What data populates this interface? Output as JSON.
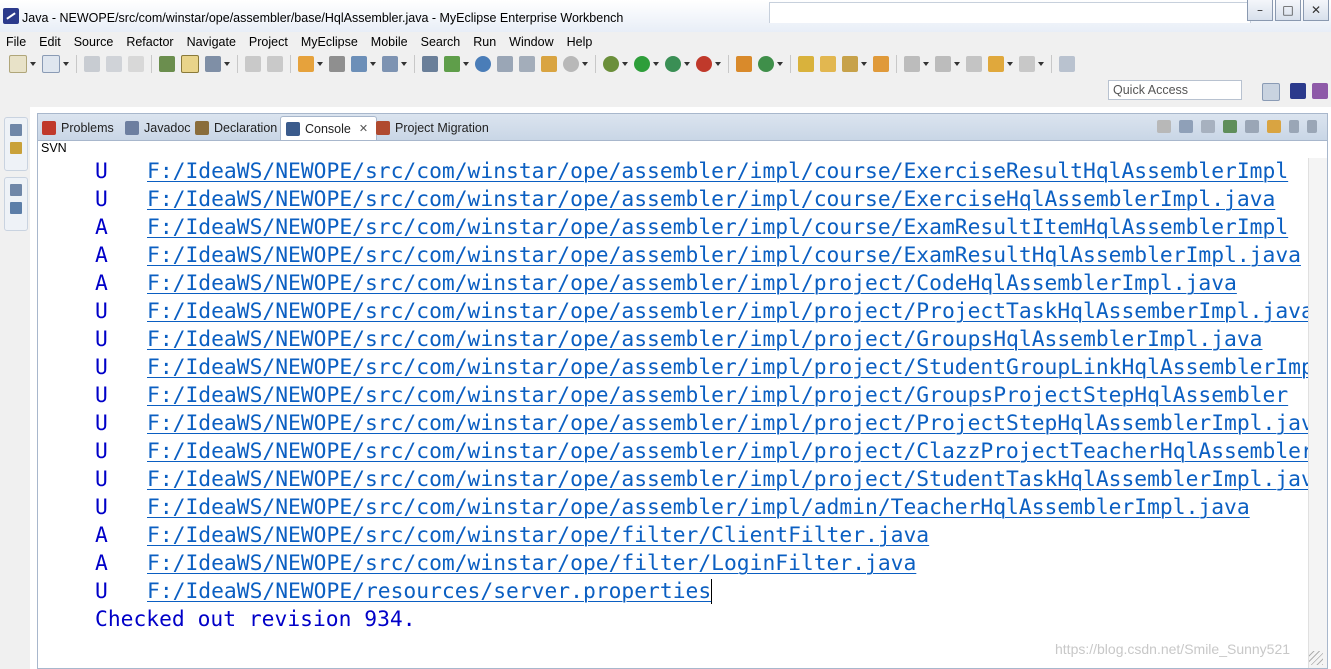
{
  "window": {
    "title": "Java - NEWOPE/src/com/winstar/ope/assembler/base/HqlAssembler.java - MyEclipse Enterprise Workbench",
    "minimize": "–",
    "maximize": "□",
    "close": "✕"
  },
  "menu": [
    "File",
    "Edit",
    "Source",
    "Refactor",
    "Navigate",
    "Project",
    "MyEclipse",
    "Mobile",
    "Search",
    "Run",
    "Window",
    "Help"
  ],
  "quick_access": {
    "label": "Quick Access"
  },
  "tabs": [
    {
      "label": "Problems",
      "color": "#c0392b"
    },
    {
      "label": "Javadoc",
      "color": "#6d7fa0"
    },
    {
      "label": "Declaration",
      "color": "#8a6d3b"
    },
    {
      "label": "Console",
      "color": "#3b5b8c",
      "active": true,
      "close": "✕"
    },
    {
      "label": "Project Migration",
      "color": "#b04a2f"
    }
  ],
  "console": {
    "name": "SVN",
    "lines": [
      {
        "status": "U",
        "path": "F:/IdeaWS/NEWOPE/src/com/winstar/ope/assembler/impl/course/ExerciseResultHqlAssemblerImpl"
      },
      {
        "status": "U",
        "path": "F:/IdeaWS/NEWOPE/src/com/winstar/ope/assembler/impl/course/ExerciseHqlAssemblerImpl.java"
      },
      {
        "status": "A",
        "path": "F:/IdeaWS/NEWOPE/src/com/winstar/ope/assembler/impl/course/ExamResultItemHqlAssemblerImpl"
      },
      {
        "status": "A",
        "path": "F:/IdeaWS/NEWOPE/src/com/winstar/ope/assembler/impl/course/ExamResultHqlAssemblerImpl.java"
      },
      {
        "status": "A",
        "path": "F:/IdeaWS/NEWOPE/src/com/winstar/ope/assembler/impl/project/CodeHqlAssemblerImpl.java"
      },
      {
        "status": "U",
        "path": "F:/IdeaWS/NEWOPE/src/com/winstar/ope/assembler/impl/project/ProjectTaskHqlAssemberImpl.java"
      },
      {
        "status": "U",
        "path": "F:/IdeaWS/NEWOPE/src/com/winstar/ope/assembler/impl/project/GroupsHqlAssemblerImpl.java"
      },
      {
        "status": "U",
        "path": "F:/IdeaWS/NEWOPE/src/com/winstar/ope/assembler/impl/project/StudentGroupLinkHqlAssemblerImpl"
      },
      {
        "status": "U",
        "path": "F:/IdeaWS/NEWOPE/src/com/winstar/ope/assembler/impl/project/GroupsProjectStepHqlAssembler"
      },
      {
        "status": "U",
        "path": "F:/IdeaWS/NEWOPE/src/com/winstar/ope/assembler/impl/project/ProjectStepHqlAssemblerImpl.java"
      },
      {
        "status": "U",
        "path": "F:/IdeaWS/NEWOPE/src/com/winstar/ope/assembler/impl/project/ClazzProjectTeacherHqlAssembler"
      },
      {
        "status": "U",
        "path": "F:/IdeaWS/NEWOPE/src/com/winstar/ope/assembler/impl/project/StudentTaskHqlAssemblerImpl.java"
      },
      {
        "status": "U",
        "path": "F:/IdeaWS/NEWOPE/src/com/winstar/ope/assembler/impl/admin/TeacherHqlAssemblerImpl.java"
      },
      {
        "status": "A",
        "path": "F:/IdeaWS/NEWOPE/src/com/winstar/ope/filter/ClientFilter.java"
      },
      {
        "status": "A",
        "path": "F:/IdeaWS/NEWOPE/src/com/winstar/ope/filter/LoginFilter.java"
      },
      {
        "status": "U",
        "path": "F:/IdeaWS/NEWOPE/resources/server.properties"
      }
    ],
    "summary": "Checked out revision 934."
  },
  "watermark": "https://blog.csdn.net/Smile_Sunny521",
  "colors": {
    "status_text": "#0000c8",
    "link_text": "#0b5fc2"
  }
}
